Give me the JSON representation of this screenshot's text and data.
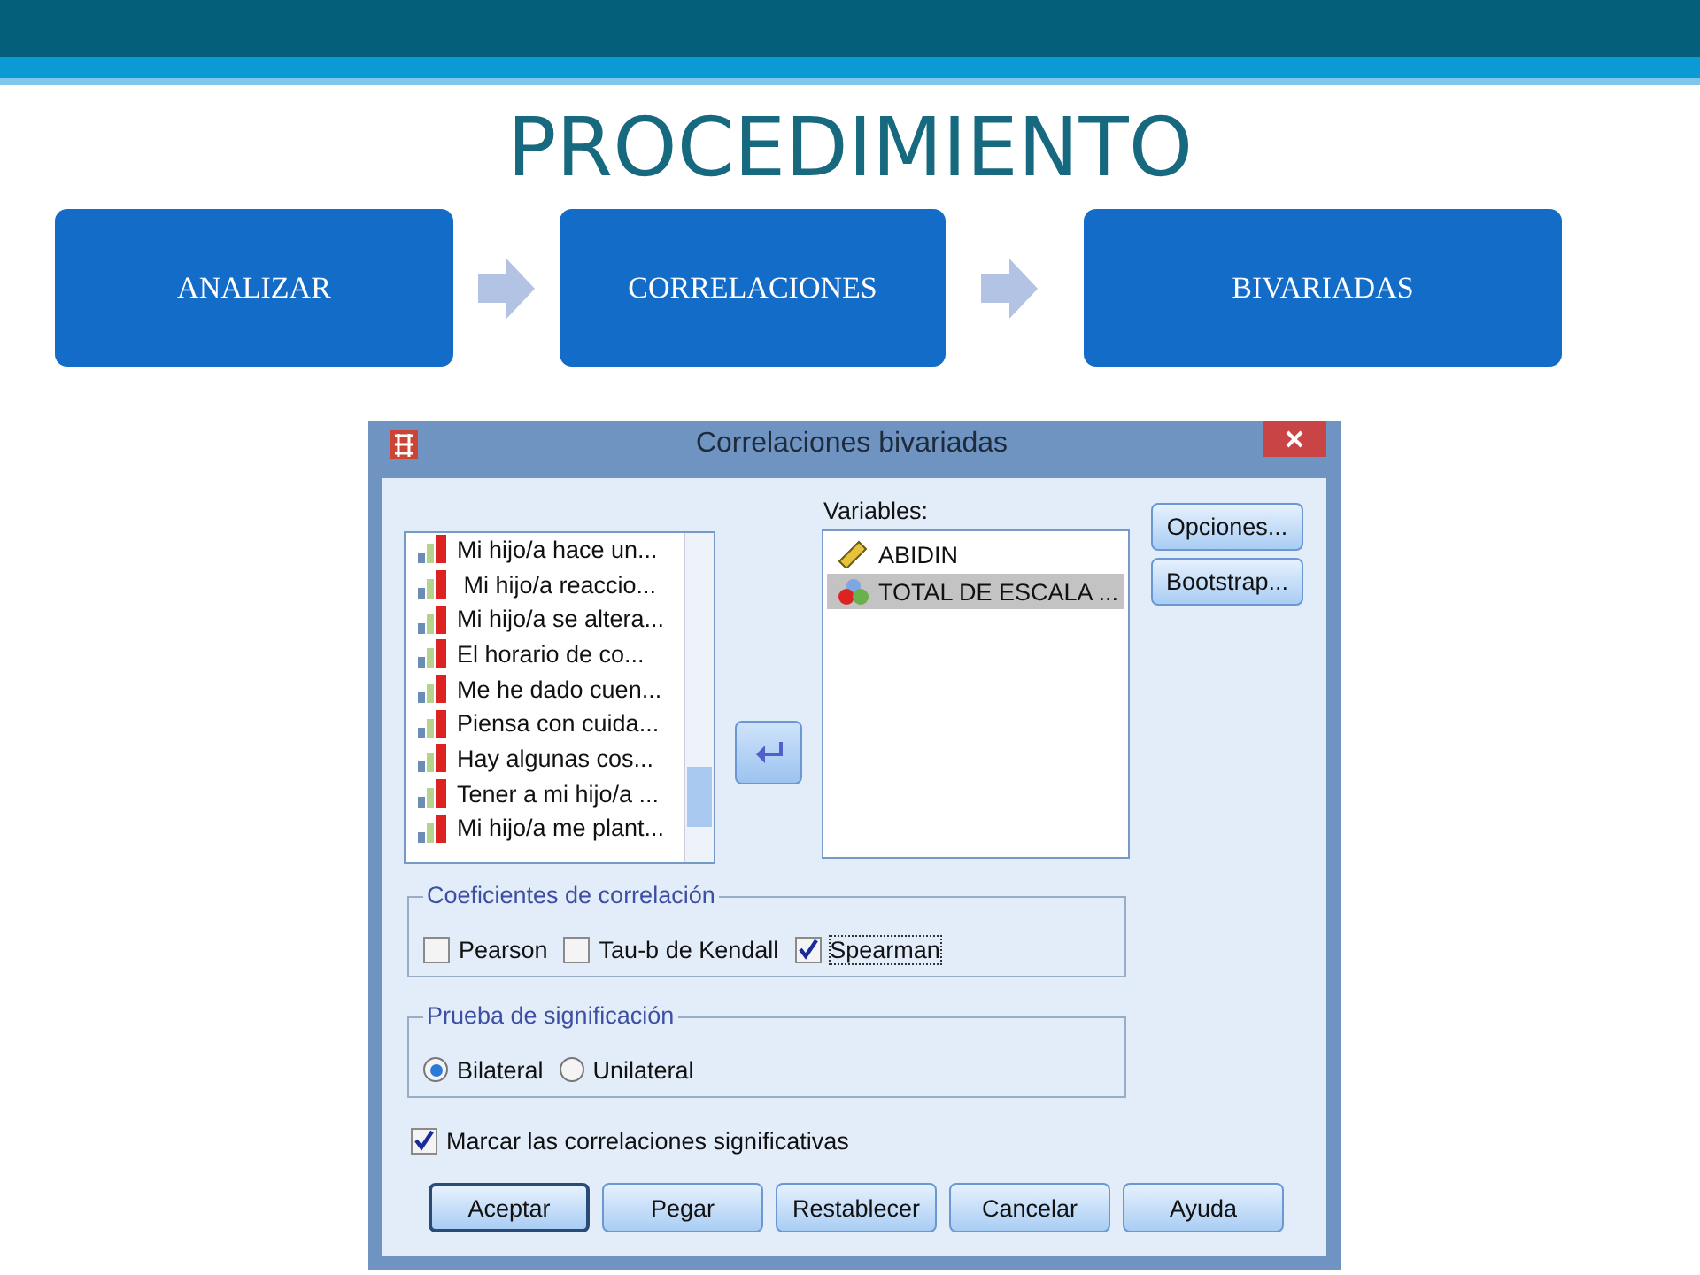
{
  "slide": {
    "title": "PROCEDIMIENTO"
  },
  "steps": [
    {
      "label": "ANALIZAR"
    },
    {
      "label": "CORRELACIONES"
    },
    {
      "label": "BIVARIADAS"
    }
  ],
  "dialog": {
    "title": "Correlaciones bivariadas",
    "source_list": [
      {
        "label": "Mi hijo/a hace un..."
      },
      {
        "label": " Mi hijo/a reaccio..."
      },
      {
        "label": "Mi hijo/a se altera..."
      },
      {
        "label": "El horario de co..."
      },
      {
        "label": "Me he dado cuen..."
      },
      {
        "label": "Piensa con cuida..."
      },
      {
        "label": "Hay algunas cos..."
      },
      {
        "label": "Tener a mi hijo/a ..."
      },
      {
        "label": "Mi hijo/a me plant..."
      }
    ],
    "variables_label": "Variables:",
    "variables": [
      {
        "label": "ABIDIN",
        "kind": "scale",
        "selected": false
      },
      {
        "label": "TOTAL DE ESCALA ...",
        "kind": "nominal",
        "selected": true
      }
    ],
    "side_buttons": [
      "Opciones...",
      "Bootstrap..."
    ],
    "coef_group": {
      "title": "Coeficientes de correlación",
      "options": [
        {
          "label": "Pearson",
          "checked": false
        },
        {
          "label": "Tau-b de Kendall",
          "checked": false
        },
        {
          "label": "Spearman",
          "checked": true
        }
      ]
    },
    "test_group": {
      "title": "Prueba de significación",
      "options": [
        {
          "label": "Bilateral",
          "selected": true
        },
        {
          "label": "Unilateral",
          "selected": false
        }
      ]
    },
    "flag": {
      "label": "Marcar las correlaciones significativas",
      "checked": true
    },
    "buttons": [
      {
        "label": "Aceptar",
        "default": true
      },
      {
        "label": "Pegar",
        "default": false
      },
      {
        "label": "Restablecer",
        "default": false
      },
      {
        "label": "Cancelar",
        "default": false
      },
      {
        "label": "Ayuda",
        "default": false
      }
    ]
  }
}
